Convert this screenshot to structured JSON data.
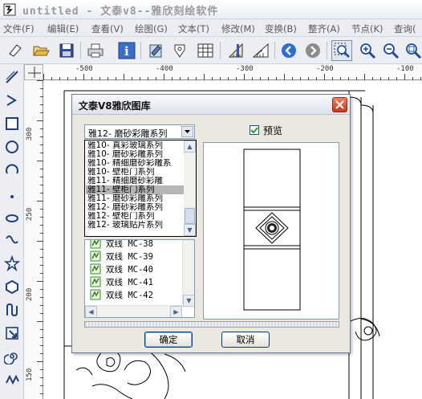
{
  "window": {
    "title": "untitled  -  文泰v8--雅欣刻绘软件",
    "app_icon": "app-logo-icon"
  },
  "menu": {
    "items": [
      "文件(F)",
      "编辑(E)",
      "查看(V)",
      "绘图(G)",
      "文本(T)",
      "修改(M)",
      "变换(B)",
      "整齐(A)",
      "节点(K)",
      "查询("
    ]
  },
  "toolbar": {
    "buttons": [
      "new-doc-icon",
      "open-folder-icon",
      "save-disk-icon",
      "print-icon",
      "info-icon",
      "import-icon",
      "pen-icon",
      "table-icon",
      "ruler-measure-icon",
      "protractor-icon",
      "back-arrow-icon",
      "forward-arrow-icon",
      "zoom-box-icon",
      "zoom-in-icon",
      "zoom-out-icon",
      "zoom-fit-icon"
    ]
  },
  "tools": [
    "line-tool-icon",
    "polyline-tool-icon",
    "rectangle-tool-icon",
    "ellipse-tool-icon",
    "arc-tool-icon",
    "point-tool-icon",
    "ring-tool-icon",
    "wave-tool-icon",
    "star-tool-icon",
    "polygon-tool-icon",
    "curve-tool-icon",
    "pick-tool-icon",
    "spiral-tool-icon",
    "zigzag-tool-icon"
  ],
  "rulers": {
    "top": [
      "-500",
      "-400",
      "-300",
      "-200",
      "-100"
    ],
    "left": [
      "300",
      "250",
      "200",
      "150"
    ]
  },
  "dialog": {
    "title": "文泰V8雅欣图库",
    "combo_value": "雅12- 磨砂彩雕系列",
    "preview_label": "预览",
    "preview_checked": true,
    "dropdown_items": [
      "雅10- 真彩玻璃系列",
      "雅10- 磨砂彩雕系列",
      "雅10- 精细磨砂彩雕系",
      "雅10- 壁柜门系列",
      "雅11- 精细磨砂彩雕",
      "雅11- 壁柜门系列",
      "雅11- 磨砂彩雕系列",
      "雅12- 磨砂彩雕系列",
      "雅12- 壁柜门系列",
      "雅12- 玻璃贴片系列"
    ],
    "dropdown_selected_index": 5,
    "tree_items": [
      "双线 MC-38",
      "双线 MC-39",
      "双线 MC-40",
      "双线 MC-41",
      "双线 MC-42"
    ],
    "ok_label": "确定",
    "cancel_label": "取消"
  },
  "colors": {
    "accent_blue": "#2d6fd1",
    "close_red": "#d9472b",
    "selection_gray": "#b5b5b5"
  }
}
